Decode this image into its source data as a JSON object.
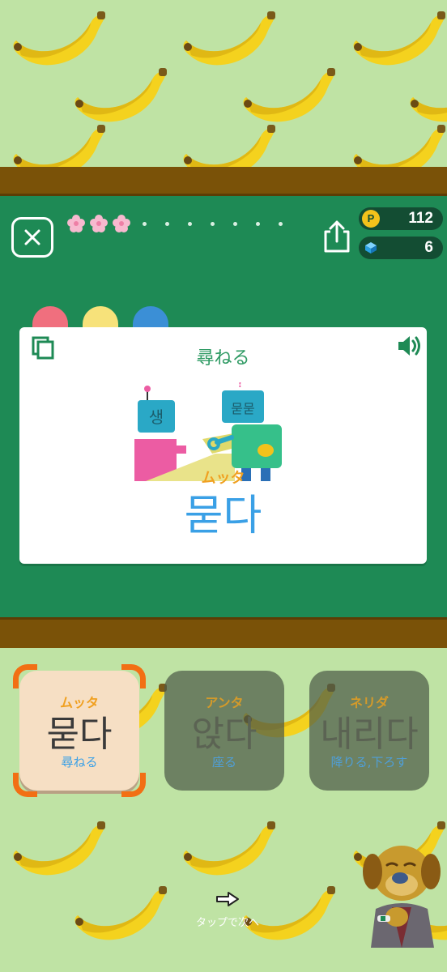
{
  "header": {
    "progress": {
      "completed": 3,
      "total": 12
    },
    "points": "112",
    "cubes": "6",
    "point_badge": "P"
  },
  "card": {
    "meaning": "尋ねる",
    "reading": "ムッタ",
    "word": "묻다",
    "illustration_text": {
      "robot_left": "생",
      "robot_right": "묻묻",
      "question": "?"
    }
  },
  "choices": [
    {
      "reading": "ムッタ",
      "word": "묻다",
      "meaning": "尋ねる",
      "selected": true
    },
    {
      "reading": "アンタ",
      "word": "앉다",
      "meaning": "座る",
      "selected": false
    },
    {
      "reading": "ネリダ",
      "word": "내리다",
      "meaning": "降りる,下ろす",
      "selected": false
    }
  ],
  "footer": {
    "next_label": "タップで次へ"
  },
  "colors": {
    "board": "#1e8a55",
    "shelf": "#7a5208",
    "background": "#bfe3a4",
    "accent_orange": "#f26f14",
    "word_blue": "#3aa0e6"
  },
  "icons": [
    "close-icon",
    "share-icon",
    "coin-icon",
    "cube-icon",
    "copy-icon",
    "speaker-icon",
    "arrow-right-icon"
  ]
}
